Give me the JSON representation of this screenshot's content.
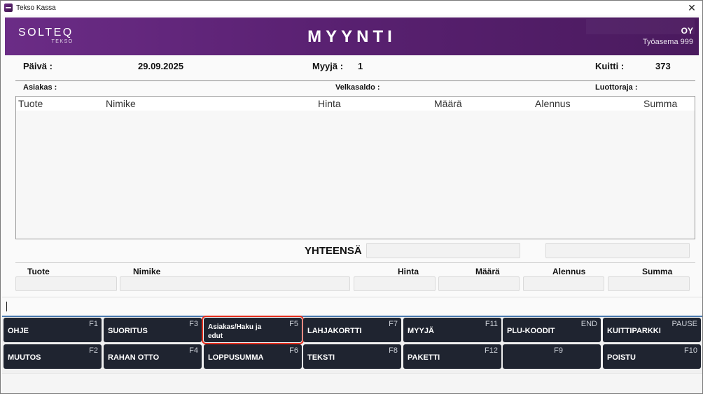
{
  "window": {
    "title": "Tekso Kassa",
    "close_symbol": "✕"
  },
  "banner": {
    "logo_main": "SOLTEQ",
    "logo_sub": "TEKSO",
    "title": "MYYNTI",
    "company": "OY",
    "station": "Työasema 999"
  },
  "info": {
    "date_label": "Päivä :",
    "date_value": "29.09.2025",
    "seller_label": "Myyjä :",
    "seller_value": "1",
    "receipt_label": "Kuitti :",
    "receipt_value": "373"
  },
  "customer": {
    "customer_label": "Asiakas :",
    "debt_label": "Velkasaldo :",
    "credit_label": "Luottoraja :"
  },
  "grid_columns": [
    "Tuote",
    "Nimike",
    "Hinta",
    "Määrä",
    "Alennus",
    "Summa"
  ],
  "total": {
    "label": "YHTEENSÄ"
  },
  "entry_columns": [
    "Tuote",
    "Nimike",
    "Hinta",
    "Määrä",
    "Alennus",
    "Summa"
  ],
  "fkeys": [
    {
      "label": "OHJE",
      "key": "F1"
    },
    {
      "label": "SUORITUS",
      "key": "F3"
    },
    {
      "label": "Asiakas/Haku ja edut",
      "key": "F5"
    },
    {
      "label": "LAHJAKORTTI",
      "key": "F7"
    },
    {
      "label": "MYYJÄ",
      "key": "F11"
    },
    {
      "label": "PLU-KOODIT",
      "key": "END"
    },
    {
      "label": "KUITTIPARKKI",
      "key": "PAUSE"
    },
    {
      "label": "MUUTOS",
      "key": "F2"
    },
    {
      "label": "RAHAN OTTO",
      "key": "F4"
    },
    {
      "label": "LOPPUSUMMA",
      "key": "F6"
    },
    {
      "label": "TEKSTI",
      "key": "F8"
    },
    {
      "label": "PAKETTI",
      "key": "F12"
    },
    {
      "label": "",
      "key": "F9"
    },
    {
      "label": "POISTU",
      "key": "F10"
    }
  ],
  "colors": {
    "banner": "#5a2172",
    "fkey_bg": "#1f2430",
    "highlight": "#e5301f",
    "accent_line": "#4a7ab0"
  }
}
